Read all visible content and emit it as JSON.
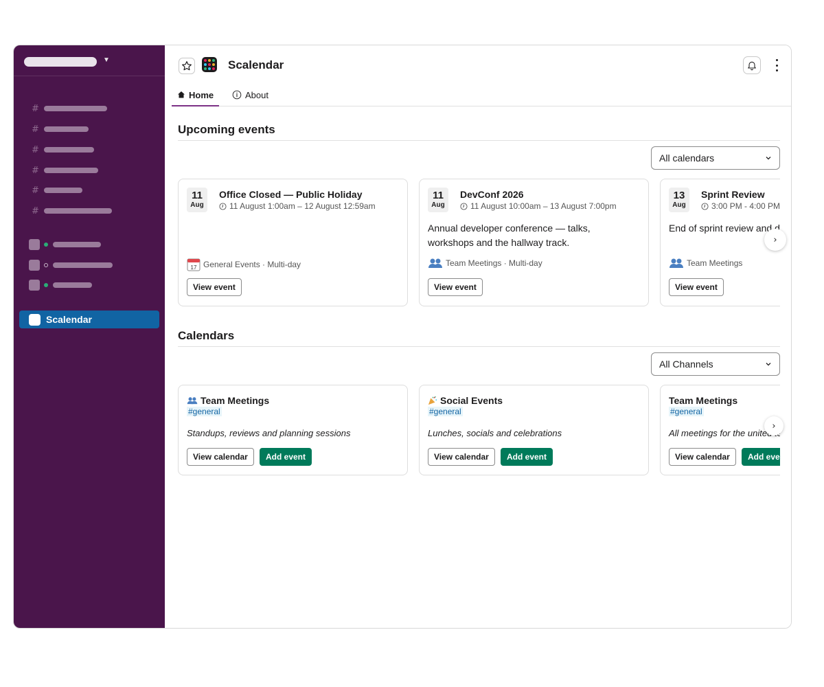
{
  "app": {
    "title": "Scalendar"
  },
  "sidebar": {
    "app_item_label": "Scalendar"
  },
  "tabs": [
    {
      "label": "Home",
      "icon": "home-icon",
      "active": true
    },
    {
      "label": "About",
      "icon": "info-icon",
      "active": false
    }
  ],
  "upcoming": {
    "title": "Upcoming events",
    "filter_value": "All calendars",
    "view_label": "View event",
    "events": [
      {
        "day": "11",
        "month": "Aug",
        "title": "Office Closed — Public Holiday",
        "time": "11 August 1:00am – 12 August 12:59am",
        "description": "",
        "meta": "General Events · Multi-day",
        "meta_icon": "calendar-icon"
      },
      {
        "day": "11",
        "month": "Aug",
        "title": "DevConf 2026",
        "time": "11 August 10:00am – 13 August 7:00pm",
        "description": "Annual developer conference — talks, workshops and the hallway track.",
        "meta": "Team Meetings · Multi-day",
        "meta_icon": "people-icon"
      },
      {
        "day": "13",
        "month": "Aug",
        "title": "Sprint Review",
        "time": "3:00 PM - 4:00 PM",
        "description": "End of sprint review and demo",
        "meta": "Team Meetings",
        "meta_icon": "people-icon"
      }
    ]
  },
  "calendars": {
    "title": "Calendars",
    "filter_value": "All Channels",
    "view_label": "View calendar",
    "add_label": "Add event",
    "items": [
      {
        "icon": "people-icon",
        "name": "Team Meetings",
        "channel": "#general",
        "description": "Standups, reviews and planning sessions"
      },
      {
        "icon": "party-popper-icon",
        "name": "Social Events",
        "channel": "#general",
        "description": "Lunches, socials and celebrations"
      },
      {
        "icon": "",
        "name": "Team Meetings",
        "channel": "#general",
        "description": "All meetings for the united team"
      }
    ]
  },
  "colors": {
    "sidebar": "#4a154b",
    "selected": "#1164a3",
    "primary_button": "#007a5a",
    "tab_underline": "#7c3085"
  }
}
